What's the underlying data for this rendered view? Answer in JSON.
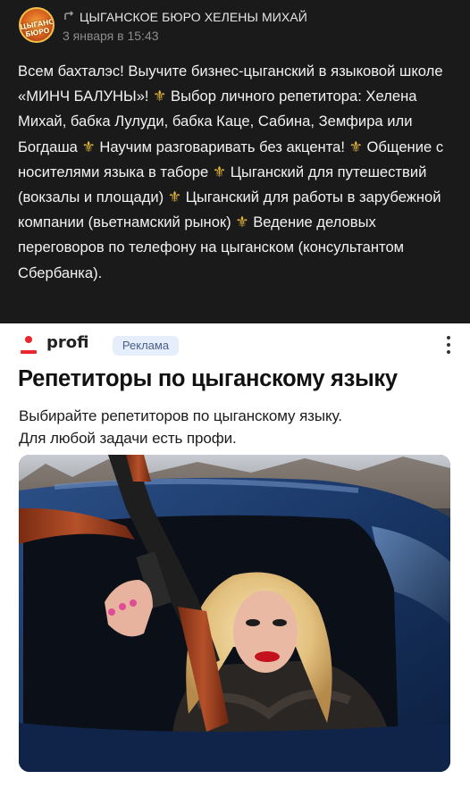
{
  "post": {
    "author": "ЦЫГАНСКОЕ БЮРО ХЕЛЕНЫ МИХАЙ",
    "avatar_text": "ЦЫГАНСКОЕ БЮРО",
    "date": "3 января в 15:43",
    "repost_icon": "repost-icon",
    "body": {
      "p1": "Всем бахталэс! Выучите бизнес-цыганский в языковой школе «МИНЧ БАЛУНЫ»! ",
      "p2": " Выбор личного репетитора: Хелена Михай, бабка Лулуди, бабка Каце, Сабина, Земфира или Богдаша ",
      "p3": " Научим разговаривать без акцента! ",
      "p4": " Общение с носителями языка в таборе ",
      "p5": " Цыганский для путешествий (вокзалы и площади) ",
      "p6": " Цыганский для работы в зарубежной компании (вьетнамский рынок) ",
      "p7": " Ведение деловых переговоров по телефону на цыганском (консультантом Сбербанка).",
      "fleur": "⚜"
    }
  },
  "ad": {
    "brand": "profi",
    "badge": "Реклама",
    "title": "Репетиторы по цыганскому языку",
    "subtitle_line1": "Выбирайте репетиторов по цыганскому языку.",
    "subtitle_line2": "Для любой задачи есть профи.",
    "colors": {
      "brand_red": "#e8282e",
      "badge_bg": "#e7eefb"
    }
  }
}
